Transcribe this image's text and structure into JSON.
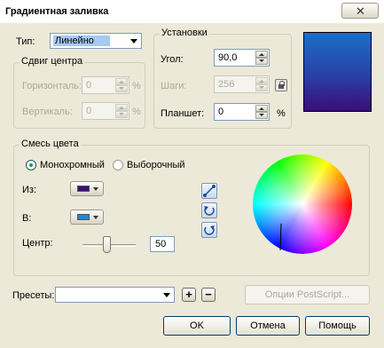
{
  "window": {
    "title": "Градиентная заливка"
  },
  "type": {
    "label": "Тип:",
    "value": "Линейно"
  },
  "offset": {
    "title": "Сдвиг центра",
    "horizontal_label": "Горизонталь:",
    "horizontal_value": "0",
    "vertical_label": "Вертикаль:",
    "vertical_value": "0",
    "unit": "%"
  },
  "settings": {
    "title": "Установки",
    "angle_label": "Угол:",
    "angle_value": "90,0",
    "steps_label": "Шаги:",
    "steps_value": "256",
    "pad_label": "Планшет:",
    "pad_value": "0",
    "unit": "%"
  },
  "blend": {
    "title": "Смесь цвета",
    "mono_label": "Монохромный",
    "custom_label": "Выборочный",
    "from_label": "Из:",
    "from_color": "#3a0d78",
    "to_label": "В:",
    "to_color": "#1b88d8",
    "center_label": "Центр:",
    "center_value": "50"
  },
  "presets": {
    "label": "Пресеты:",
    "value": ""
  },
  "buttons": {
    "postscript": "Опции PostScript...",
    "ok": "OK",
    "cancel": "Отмена",
    "help": "Помощь",
    "add": "+",
    "remove": "−"
  }
}
